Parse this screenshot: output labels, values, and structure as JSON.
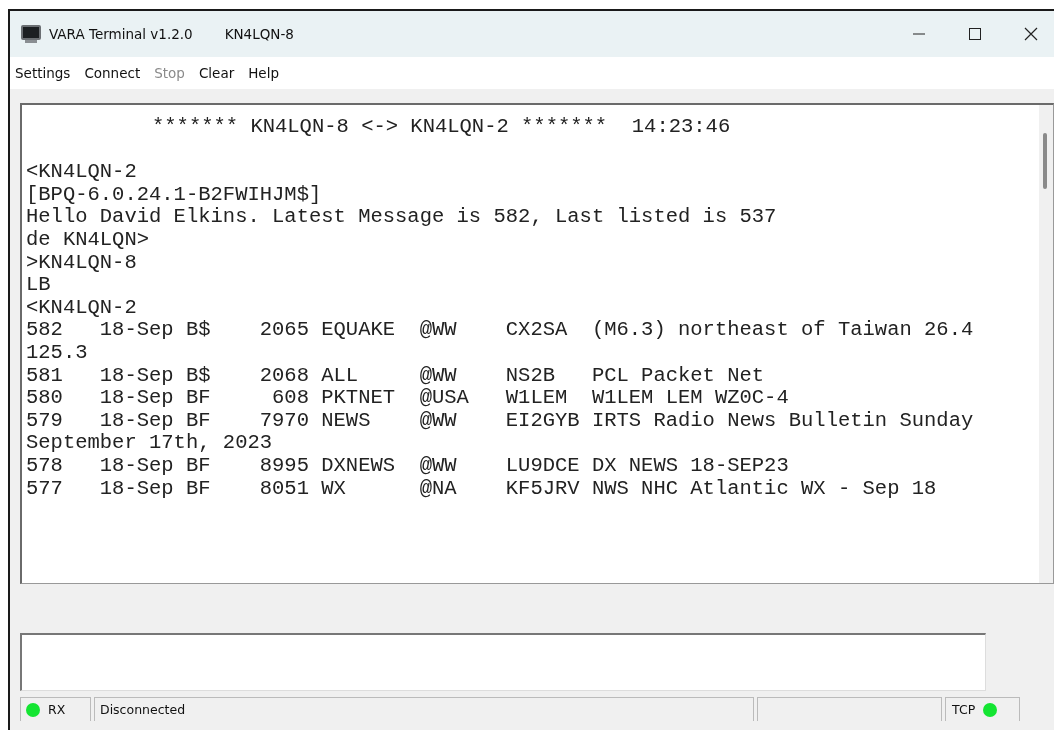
{
  "window": {
    "title": "VARA Terminal v1.2.0",
    "callsign": "KN4LQN-8"
  },
  "menu": [
    {
      "label": "Settings",
      "disabled": false
    },
    {
      "label": "Connect",
      "disabled": false
    },
    {
      "label": "Stop",
      "disabled": true
    },
    {
      "label": "Clear",
      "disabled": false
    },
    {
      "label": "Help",
      "disabled": false
    }
  ],
  "terminal": {
    "lines": [
      {
        "kind": "banner",
        "text": "******* KN4LQN-8 <-> KN4LQN-2 *******  14:23:46"
      },
      {
        "kind": "text",
        "text": "<KN4LQN-2"
      },
      {
        "kind": "text",
        "text": "[BPQ-6.0.24.1-B2FWIHJM$]"
      },
      {
        "kind": "text",
        "text": "Hello David Elkins. Latest Message is 582, Last listed is 537"
      },
      {
        "kind": "text",
        "text": "de KN4LQN>"
      },
      {
        "kind": "text",
        "text": ">KN4LQN-8"
      },
      {
        "kind": "text",
        "text": "LB"
      },
      {
        "kind": "text",
        "text": "<KN4LQN-2"
      },
      {
        "kind": "text",
        "text": "582   18-Sep B$    2065 EQUAKE  @WW    CX2SA  (M6.3) northeast of Taiwan 26.4"
      },
      {
        "kind": "text",
        "text": "125.3"
      },
      {
        "kind": "text",
        "text": "581   18-Sep B$    2068 ALL     @WW    NS2B   PCL Packet Net"
      },
      {
        "kind": "text",
        "text": "580   18-Sep BF     608 PKTNET  @USA   W1LEM  W1LEM LEM WZ0C-4"
      },
      {
        "kind": "text",
        "text": "579   18-Sep BF    7970 NEWS    @WW    EI2GYB IRTS Radio News Bulletin Sunday"
      },
      {
        "kind": "text",
        "text": "September 17th, 2023"
      },
      {
        "kind": "text",
        "text": "578   18-Sep BF    8995 DXNEWS  @WW    LU9DCE DX NEWS 18-SEP23"
      },
      {
        "kind": "text",
        "text": "577   18-Sep BF    8051 WX      @NA    KF5JRV NWS NHC Atlantic WX - Sep 18"
      }
    ]
  },
  "status_bar": {
    "rx": {
      "label": "RX",
      "on": true
    },
    "status": "Disconnected",
    "tcp": {
      "label": "TCP",
      "on": true
    }
  }
}
